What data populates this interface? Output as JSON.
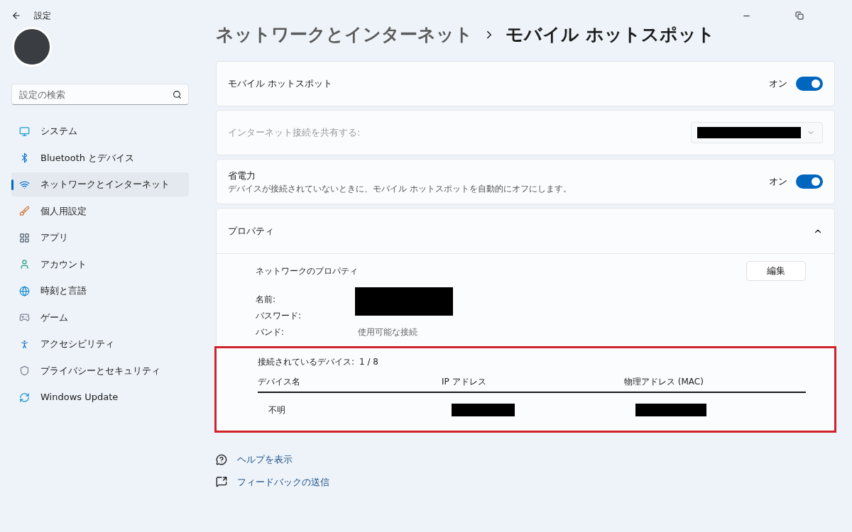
{
  "window": {
    "title": "設定"
  },
  "sidebar": {
    "search": {
      "placeholder": "設定の検索"
    },
    "items": [
      {
        "label": "システム",
        "selected": false
      },
      {
        "label": "Bluetooth とデバイス",
        "selected": false
      },
      {
        "label": "ネットワークとインターネット",
        "selected": true
      },
      {
        "label": "個人用設定",
        "selected": false
      },
      {
        "label": "アプリ",
        "selected": false
      },
      {
        "label": "アカウント",
        "selected": false
      },
      {
        "label": "時刻と言語",
        "selected": false
      },
      {
        "label": "ゲーム",
        "selected": false
      },
      {
        "label": "アクセシビリティ",
        "selected": false
      },
      {
        "label": "プライバシーとセキュリティ",
        "selected": false
      },
      {
        "label": "Windows Update",
        "selected": false
      }
    ]
  },
  "breadcrumb": {
    "parent": "ネットワークとインターネット",
    "current": "モバイル ホットスポット"
  },
  "settings": [
    {
      "kind": "toggle",
      "label": "モバイル ホットスポット",
      "state_label": "オン",
      "on": true
    },
    {
      "kind": "dropdown",
      "label": "インターネット接続を共有する:",
      "disabled": true
    },
    {
      "kind": "toggle",
      "label": "省電力",
      "description": "デバイスが接続されていないときに、モバイル ホットスポットを自動的にオフにします。",
      "state_label": "オン",
      "on": true
    }
  ],
  "properties": {
    "title": "プロパティ",
    "expanded": true,
    "network_title": "ネットワークのプロパティ",
    "edit_button": "編集",
    "fields": [
      {
        "label": "名前:"
      },
      {
        "label": "パスワード:"
      },
      {
        "label": "バンド:",
        "value": "使用可能な接続"
      }
    ],
    "devices": {
      "label": "接続されているデバイス:",
      "count": "1 / 8",
      "highlighted": true,
      "columns": [
        "デバイス名",
        "IP アドレス",
        "物理アドレス (MAC)"
      ],
      "rows": [
        {
          "name": "不明"
        }
      ]
    }
  },
  "links": [
    {
      "label": "ヘルプを表示"
    },
    {
      "label": "フィードバックの送信"
    }
  ]
}
